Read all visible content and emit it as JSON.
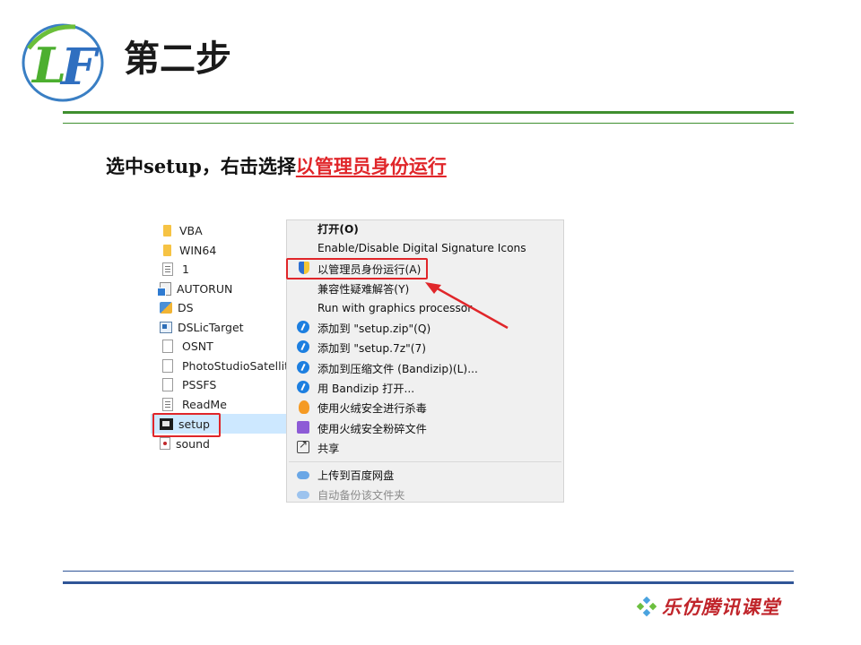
{
  "slide": {
    "title": "第二步",
    "instruction_prefix": "选中setup，右击选择",
    "instruction_highlight": "以管理员身份运行",
    "brand_text": "乐仿腾讯课堂",
    "logo_text": "LF"
  },
  "colors": {
    "accent_red": "#e0262a",
    "rule_green": "#3f8f2f",
    "rule_blue": "#2f5597",
    "selection_blue": "#cde8ff",
    "menu_background": "#f0f0f0"
  },
  "files": [
    {
      "name": "VBA",
      "icon": "folder-icon"
    },
    {
      "name": "WIN64",
      "icon": "folder-icon"
    },
    {
      "name": "1",
      "icon": "text-file-icon"
    },
    {
      "name": "AUTORUN",
      "icon": "autorun-icon"
    },
    {
      "name": "DS",
      "icon": "ds-app-icon"
    },
    {
      "name": "DSLicTarget",
      "icon": "application-icon"
    },
    {
      "name": "OSNT",
      "icon": "file-icon"
    },
    {
      "name": "PhotoStudioSatellite",
      "icon": "file-icon"
    },
    {
      "name": "PSSFS",
      "icon": "file-icon"
    },
    {
      "name": "ReadMe",
      "icon": "text-file-icon"
    },
    {
      "name": "setup",
      "icon": "setup-app-icon",
      "selected": true
    },
    {
      "name": "sound",
      "icon": "sound-file-icon"
    }
  ],
  "context_menu": {
    "items": [
      {
        "label": "打开(O)",
        "icon": "",
        "bold": true
      },
      {
        "label": "Enable/Disable Digital Signature Icons",
        "icon": ""
      },
      {
        "label": "以管理员身份运行(A)",
        "icon": "uac-shield-icon",
        "highlighted": true
      },
      {
        "label": "兼容性疑难解答(Y)",
        "icon": ""
      },
      {
        "label": "Run with graphics processor",
        "icon": ""
      },
      {
        "label": "添加到 \"setup.zip\"(Q)",
        "icon": "bandizip-icon"
      },
      {
        "label": "添加到 \"setup.7z\"(7)",
        "icon": "bandizip-icon"
      },
      {
        "label": "添加到压缩文件 (Bandizip)(L)...",
        "icon": "bandizip-icon"
      },
      {
        "label": "用 Bandizip 打开...",
        "icon": "bandizip-icon"
      },
      {
        "label": "使用火绒安全进行杀毒",
        "icon": "huorong-fire-icon"
      },
      {
        "label": "使用火绒安全粉碎文件",
        "icon": "huorong-shred-icon"
      },
      {
        "label": "共享",
        "icon": "share-icon"
      },
      {
        "label": "上传到百度网盘",
        "icon": "baidu-cloud-icon"
      },
      {
        "label": "自动备份该文件夹",
        "icon": "baidu-cloud-icon",
        "disabled": true
      }
    ]
  }
}
